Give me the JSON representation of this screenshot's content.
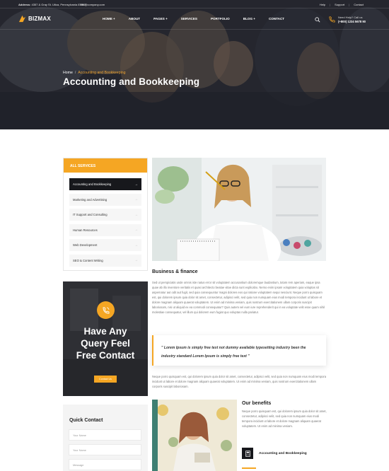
{
  "topbar": {
    "address_label": "Address:",
    "address": "4357 & Gray St. Utica, Pennsylvania 87567",
    "email": "info@company.com",
    "links": [
      "Help",
      "Support",
      "Contact"
    ]
  },
  "brand": {
    "name": "BIZMAX"
  },
  "nav": {
    "items": [
      "HOME +",
      "ABOUT",
      "PAGES +",
      "SERVICES",
      "PORTFOLIO",
      "BLOG +",
      "CONTACT"
    ],
    "help_label": "Need Help? Call us",
    "phone": "(+800) 1234 5678 90"
  },
  "breadcrumb": {
    "home": "Home",
    "separator": "/",
    "current": "Accounting and Bookkeeping"
  },
  "page_title": "Accounting and Bookkeeping",
  "sidebar": {
    "heading": "ALL SERVICES",
    "items": [
      "Accounting and Bookkeeping",
      "Marketing and Advertising",
      "IT Support and Consulting",
      "Human Resources",
      "Web Development",
      "SEO & Content Writing"
    ],
    "arrow": "→"
  },
  "query": {
    "line1": "Have Any",
    "line2": "Query Feel",
    "line3": "Free Contact",
    "button": "Contact Us"
  },
  "quick_contact": {
    "title": "Quick Contact",
    "name_placeholder": "Your Name",
    "email_placeholder": "Your Name",
    "message_placeholder": "Message"
  },
  "content": {
    "heading": "Business & finance",
    "paragraph1": "Sed ut perspiciatis unde omnis iste natus error sit voluptatem accusantium doloremque laudantium, totam rem aperiam, eaque ipsa quae ab illo inventore veritatis et quasi architecto beatae vitae dicta sunt explicabo. Nemo enim ipsam voluptatem quia voluptas sit aspernatur aut odit aut fugit, sed quia consequuntur magni dolores eos qui ratione voluptatem sequi nesciunt. Neque porro quisquam est, qui dolorem ipsum quia dolor sit amet, consectetur, adipisci velit, sed quia non numquam eius modi tempora incidunt ut labore et dolore magnam aliquam quaerat voluptatem. Ut enim ad minima veniam, quis nostrum exercitationem ullam corporis suscipit laboriosam, nisi ut aliquid ex ea commodi consequatur? Quis autem vel eum iure reprehenderit qui in ea voluptate velit esse quam nihil molestiae consequatur, vel illum qui dolorem eum fugiat quo voluptas nulla pariatur.",
    "quote": "\" Lorem Ipsum is simply free text not dummy available typesetting industry been the industry standard Lorem Ipsum is simply free text \"",
    "paragraph2": "Neque porro quisquam est, qui dolorem ipsum quia dolor sit amet, consectetur, adipisci velit, sed quia non numquam eius modi tempora incidunt ut labore et dolore magnam aliquam quaerat voluptatem. Ut enim ad minima veniam, quis nostrum exercitationem ullam corporis suscipit laboriosam.",
    "benefits_title": "Our benefits",
    "benefits_text": "Neque porro quisquam est, qui dolorem ipsum quia dolor sit amet, consectetur, adipisci velit, sed quia non numquam eius modi tempora incidunt ut labore et dolore magnam aliquam quaerat voluptatem. Ut enim ad minima veniam.",
    "benefit_item": "Accounting and Bookkeeping"
  },
  "colors": {
    "accent": "#f5a623",
    "dark": "#17181c"
  },
  "icons": [
    "logo-icon",
    "search-icon",
    "phone-icon",
    "arrow-right-icon",
    "phone-call-icon",
    "calculator-icon"
  ]
}
